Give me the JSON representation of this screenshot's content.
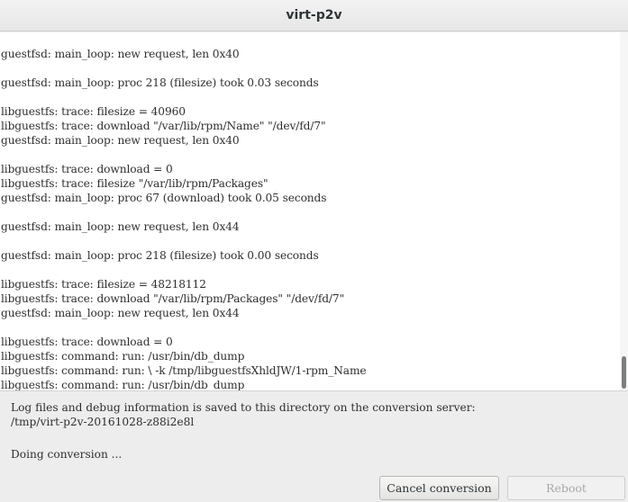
{
  "window": {
    "title": "virt-p2v"
  },
  "log": {
    "lines": [
      "guestfsd: main_loop: new request, len 0x40",
      "",
      "guestfsd: main_loop: proc 218 (filesize) took 0.03 seconds",
      "",
      "libguestfs: trace: filesize = 40960",
      "libguestfs: trace: download \"/var/lib/rpm/Name\" \"/dev/fd/7\"",
      "guestfsd: main_loop: new request, len 0x40",
      "",
      "libguestfs: trace: download = 0",
      "libguestfs: trace: filesize \"/var/lib/rpm/Packages\"",
      "guestfsd: main_loop: proc 67 (download) took 0.05 seconds",
      "",
      "guestfsd: main_loop: new request, len 0x44",
      "",
      "guestfsd: main_loop: proc 218 (filesize) took 0.00 seconds",
      "",
      "libguestfs: trace: filesize = 48218112",
      "libguestfs: trace: download \"/var/lib/rpm/Packages\" \"/dev/fd/7\"",
      "guestfsd: main_loop: new request, len 0x44",
      "",
      "libguestfs: trace: download = 0",
      "libguestfs: command: run: /usr/bin/db_dump",
      "libguestfs: command: run: \\ -k /tmp/libguestfsXhldJW/1-rpm_Name",
      "libguestfs: command: run: /usr/bin/db_dump"
    ]
  },
  "info": {
    "message": "Log files and debug information is saved to this directory on the conversion server:",
    "path": "/tmp/virt-p2v-20161028-z88i2e8l"
  },
  "status": {
    "text": "Doing conversion ..."
  },
  "buttons": {
    "cancel_label": "Cancel conversion",
    "reboot_label": "Reboot"
  }
}
